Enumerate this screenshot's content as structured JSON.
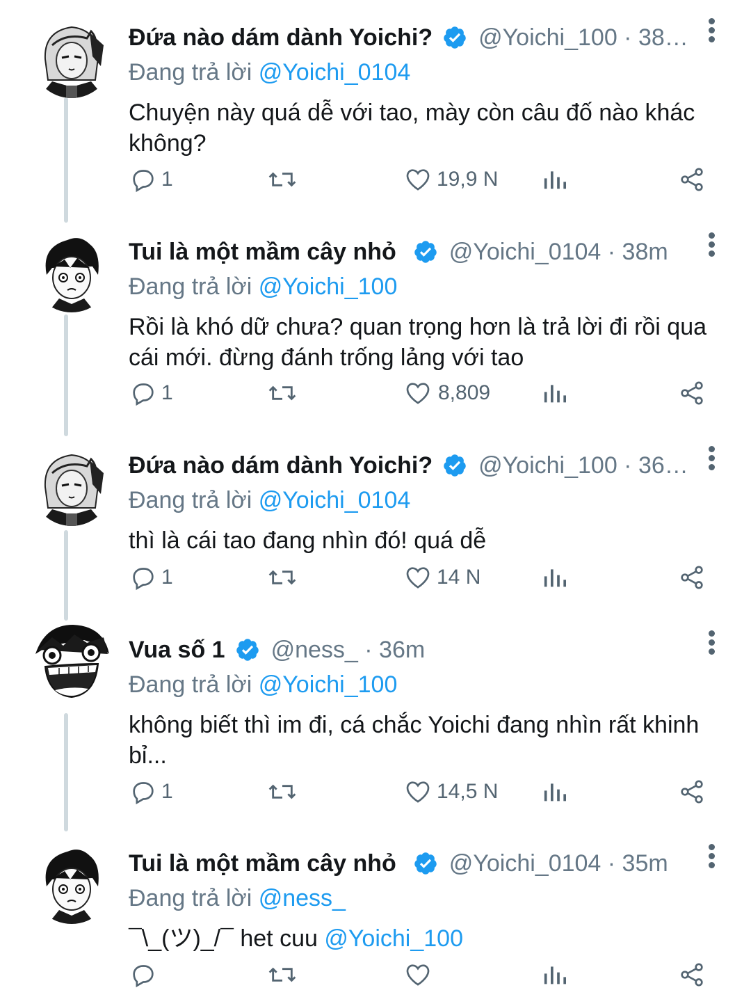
{
  "colors": {
    "accent": "#1d9bf0",
    "secondary_text": "#657786",
    "icon": "#536471",
    "thread_line": "#cfd9de"
  },
  "reply_prefix": "Đang trả lời",
  "tweets": [
    {
      "name": "Đứa nào dám dành Yoichi?",
      "verified": true,
      "meta": "@Yoichi_100 · 38…",
      "reply_handle": "@Yoichi_0104",
      "text": "Chuyện này quá dễ với tao, mày còn câu đố nào khác không?",
      "replies": "1",
      "likes": "19,9 N",
      "avatar_icon": "girl-avatar-icon"
    },
    {
      "name": "Tui là một mầm cây nhỏ",
      "verified": true,
      "meta": "@Yoichi_0104 · 38m",
      "reply_handle": "@Yoichi_100",
      "text": "Rồi là khó dữ chưa? quan trọng hơn là trả lời đi rồi qua cái mới. đừng đánh trống lảng với tao",
      "replies": "1",
      "likes": "8,809",
      "avatar_icon": "boy-avatar-icon"
    },
    {
      "name": "Đứa nào dám dành Yoichi?",
      "verified": true,
      "meta": "@Yoichi_100 · 36…",
      "reply_handle": "@Yoichi_0104",
      "text": "thì là cái tao đang nhìn đó! quá dễ",
      "replies": "1",
      "likes": "14 N",
      "avatar_icon": "girl-avatar-icon"
    },
    {
      "name": "Vua số 1",
      "verified": true,
      "meta": "@ness_ · 36m",
      "reply_handle": "@Yoichi_100",
      "text": "không biết thì im đi, cá chắc Yoichi đang nhìn rất khinh bỉ...",
      "replies": "1",
      "likes": "14,5 N",
      "avatar_icon": "laughing-avatar-icon"
    },
    {
      "name": "Tui là một mầm cây nhỏ",
      "verified": true,
      "meta": "@Yoichi_0104 · 35m",
      "reply_handle": "@ness_",
      "text": "¯\\_(ツ)_/¯ het cuu ",
      "text_mention": "@Yoichi_100",
      "replies": "",
      "likes": "",
      "avatar_icon": "boy-avatar-icon"
    }
  ]
}
